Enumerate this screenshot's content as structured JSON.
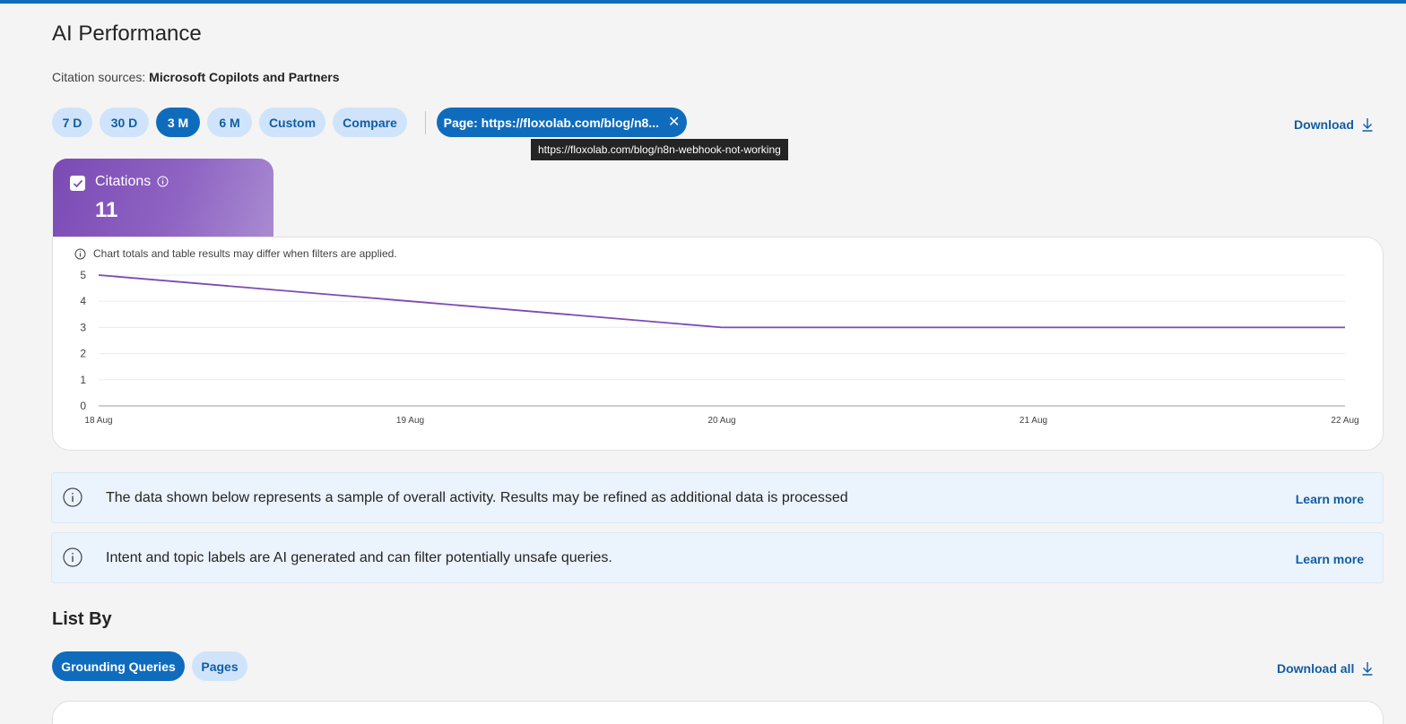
{
  "header": {
    "title": "AI Performance",
    "citation_prefix": "Citation sources: ",
    "citation_sources": "Microsoft Copilots and Partners"
  },
  "range_pills": [
    {
      "label": "7 D",
      "active": false
    },
    {
      "label": "30 D",
      "active": false
    },
    {
      "label": "3 M",
      "active": true
    },
    {
      "label": "6 M",
      "active": false
    },
    {
      "label": "Custom",
      "active": false
    },
    {
      "label": "Compare",
      "active": false
    }
  ],
  "filter_chip": {
    "label": "Page: https://floxolab.com/blog/n8...",
    "tooltip": "https://floxolab.com/blog/n8n-webhook-not-working"
  },
  "download_label": "Download",
  "metric": {
    "label": "Citations",
    "value": "11",
    "checked": true
  },
  "chart_note": "Chart totals and table results may differ when filters are applied.",
  "chart_data": {
    "type": "line",
    "categories": [
      "18 Aug",
      "19 Aug",
      "20 Aug",
      "21 Aug",
      "22 Aug"
    ],
    "series": [
      {
        "name": "Citations",
        "values": [
          5,
          4,
          3,
          3,
          3
        ],
        "color": "#7b4ab5"
      }
    ],
    "yticks": [
      0,
      1,
      2,
      3,
      4,
      5
    ],
    "ylim": [
      0,
      5
    ],
    "grid": true
  },
  "banners": [
    {
      "text": "The data shown below represents a sample of overall activity. Results may be refined as additional data is processed",
      "link": "Learn more"
    },
    {
      "text": "Intent and topic labels are AI generated and can filter potentially unsafe queries.",
      "link": "Learn more"
    }
  ],
  "list_by": {
    "title": "List By",
    "tabs": [
      {
        "label": "Grounding Queries",
        "active": true
      },
      {
        "label": "Pages",
        "active": false
      }
    ],
    "download_all": "Download all"
  },
  "colors": {
    "accent": "#0f6cbd",
    "pill_bg": "#cfe4fa",
    "metric_purple": "#7b4ab5"
  }
}
